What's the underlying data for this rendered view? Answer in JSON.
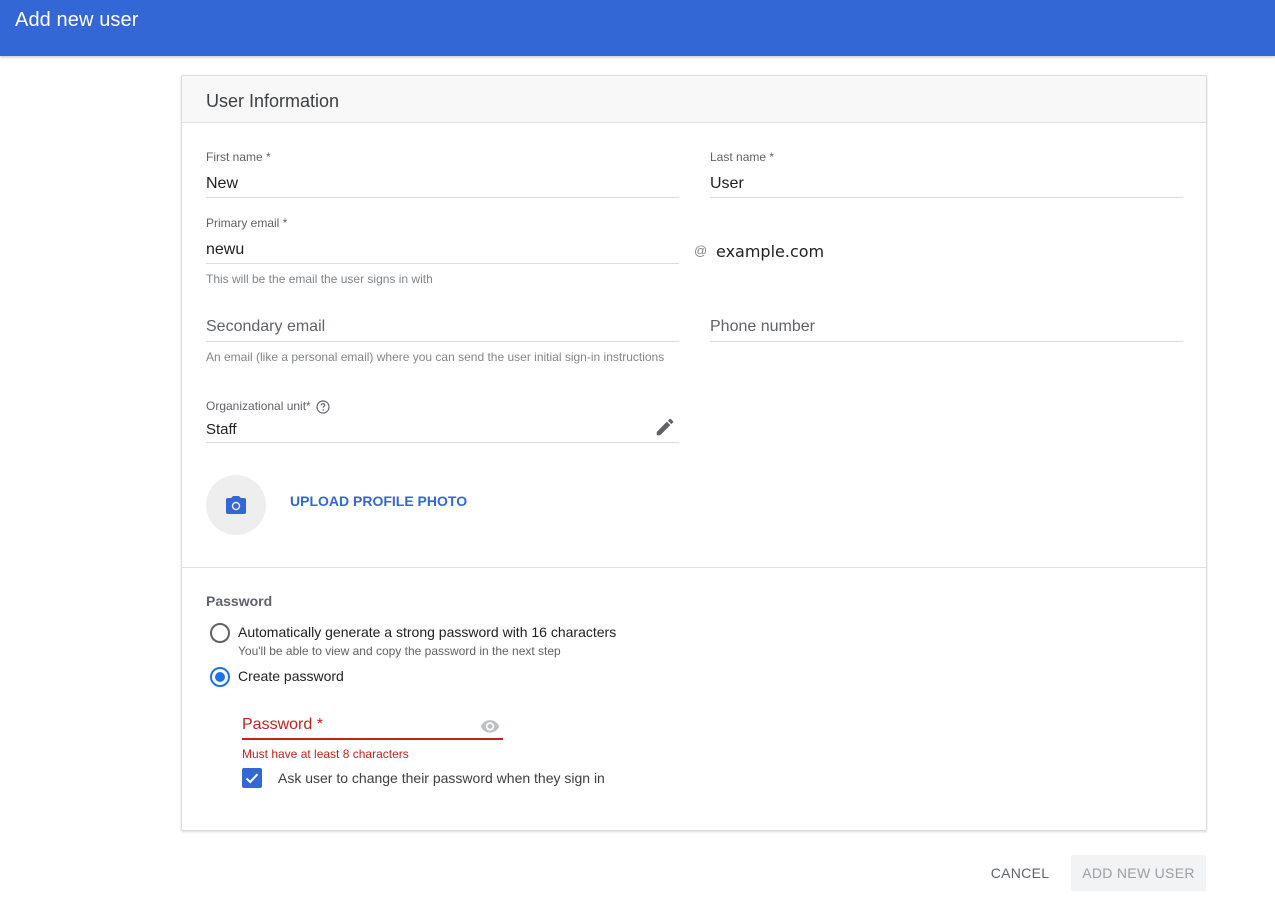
{
  "page": {
    "title": "Add new user"
  },
  "colors": {
    "topbar": "#3367d6",
    "accent": "#3367d6",
    "radio_accent": "#1a73e8",
    "error": "#c5221f"
  },
  "card": {
    "header": "User Information",
    "first_name": {
      "label": "First name *",
      "value": "New"
    },
    "last_name": {
      "label": "Last name *",
      "value": "User"
    },
    "primary_email": {
      "label": "Primary email *",
      "value": "newu",
      "at": "@",
      "domain": "example.com",
      "hint": "This will be the email the user signs in with"
    },
    "secondary_email": {
      "placeholder": "Secondary email",
      "hint": "An email (like a personal email) where you can send the user initial sign-in instructions"
    },
    "phone": {
      "placeholder": "Phone number"
    },
    "org_unit": {
      "label": "Organizational unit*",
      "value": "Staff",
      "help_icon": "help-circle-icon",
      "edit_icon": "pencil-icon"
    },
    "photo": {
      "icon": "camera-icon",
      "upload_label": "UPLOAD PROFILE PHOTO"
    }
  },
  "password": {
    "section_label": "Password",
    "options": [
      {
        "label": "Automatically generate a strong password with 16 characters",
        "sub": "You'll be able to view and copy the password in the next step",
        "checked": false
      },
      {
        "label": "Create password",
        "checked": true
      }
    ],
    "field": {
      "placeholder": "Password *",
      "error": "Must have at least 8 characters",
      "icon": "eye-icon"
    },
    "change_on_signin": {
      "label": "Ask user to change their password when they sign in",
      "checked": true
    }
  },
  "actions": {
    "cancel": "CANCEL",
    "add": "ADD NEW USER"
  }
}
